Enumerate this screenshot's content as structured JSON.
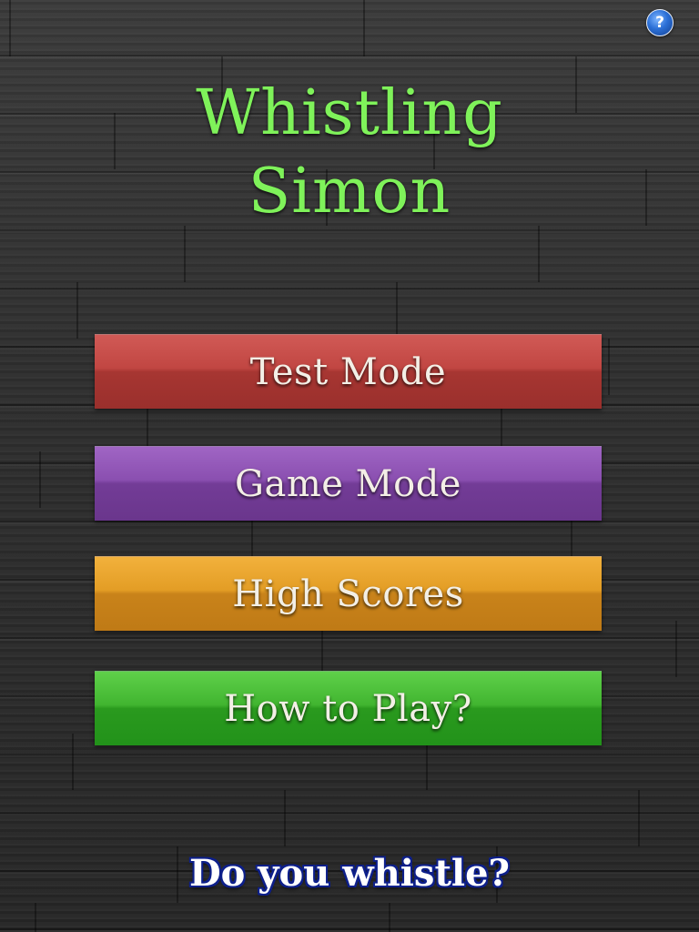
{
  "header": {
    "help_label": "?",
    "help_icon": "question-mark-icon"
  },
  "title": {
    "line1": "Whistling",
    "line2": "Simon"
  },
  "menu": {
    "test_mode": "Test Mode",
    "game_mode": "Game Mode",
    "high_scores": "High Scores",
    "how_to_play": "How to Play?"
  },
  "footer": {
    "tagline": "Do you whistle?"
  },
  "colors": {
    "title": "#7ff25a",
    "test_mode": "#b53e3a",
    "game_mode": "#8046a6",
    "high_scores": "#d88e20",
    "how_to_play": "#36a826",
    "tagline_outline": "#0d1f8a",
    "background": "#2e2e2e"
  }
}
